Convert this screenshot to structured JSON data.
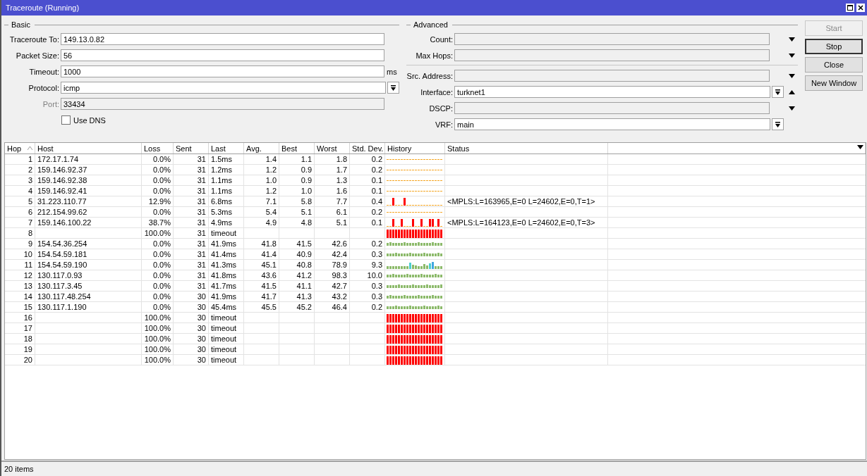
{
  "window": {
    "title": "Traceroute (Running)"
  },
  "basic": {
    "title": "Basic",
    "fields": [
      {
        "label": "Traceroute To:",
        "value": "149.13.0.82",
        "kind": "text",
        "disabled": false
      },
      {
        "label": "Packet Size:",
        "value": "56",
        "kind": "text",
        "disabled": false
      },
      {
        "label": "Timeout:",
        "value": "1000",
        "unit": "ms",
        "kind": "text",
        "disabled": false
      },
      {
        "label": "Protocol:",
        "value": "icmp",
        "kind": "select",
        "disabled": false
      },
      {
        "label": "Port:",
        "value": "33434",
        "kind": "text",
        "disabled": true
      }
    ],
    "use_dns": {
      "label": "Use DNS",
      "checked": false
    }
  },
  "advanced": {
    "title": "Advanced",
    "groups": [
      [
        {
          "label": "Count:",
          "kind": "optional"
        },
        {
          "label": "Max Hops:",
          "kind": "optional"
        }
      ],
      [
        {
          "label": "Src. Address:",
          "kind": "optional"
        },
        {
          "label": "Interface:",
          "value": "turknet1",
          "kind": "select-expanded"
        },
        {
          "label": "DSCP:",
          "kind": "optional"
        },
        {
          "label": "VRF:",
          "value": "main",
          "kind": "select"
        }
      ]
    ]
  },
  "buttons": [
    {
      "label": "Start",
      "disabled": true,
      "focused": false
    },
    {
      "label": "Stop",
      "disabled": false,
      "focused": true
    },
    {
      "label": "Close",
      "disabled": false,
      "focused": false
    },
    {
      "label": "New Window",
      "disabled": false,
      "focused": false
    }
  ],
  "table": {
    "columns": [
      {
        "label": "Hop",
        "sorted": true
      },
      {
        "label": "Host",
        "sorted": false
      },
      {
        "label": "Loss",
        "sorted": false
      },
      {
        "label": "Sent",
        "sorted": false
      },
      {
        "label": "Last",
        "sorted": false
      },
      {
        "label": "Avg.",
        "sorted": false
      },
      {
        "label": "Best",
        "sorted": false
      },
      {
        "label": "Worst",
        "sorted": false
      },
      {
        "label": "Std. Dev.",
        "sorted": false
      },
      {
        "label": "History",
        "sorted": false
      },
      {
        "label": "Status",
        "sorted": false
      }
    ],
    "rows": [
      {
        "hop": "1",
        "host": "172.17.1.74",
        "loss": "0.0%",
        "sent": "31",
        "last": "1.5ms",
        "avg": "1.4",
        "best": "1.1",
        "worst": "1.8",
        "std_dev": "0.2",
        "history": {
          "kind": "dashed"
        }
      },
      {
        "hop": "2",
        "host": "159.146.92.37",
        "loss": "0.0%",
        "sent": "31",
        "last": "1.2ms",
        "avg": "1.2",
        "best": "0.9",
        "worst": "1.7",
        "std_dev": "0.2",
        "history": {
          "kind": "dashed"
        }
      },
      {
        "hop": "3",
        "host": "159.146.92.38",
        "loss": "0.0%",
        "sent": "31",
        "last": "1.1ms",
        "avg": "1.0",
        "best": "0.9",
        "worst": "1.3",
        "std_dev": "0.1",
        "history": {
          "kind": "dashed"
        }
      },
      {
        "hop": "4",
        "host": "159.146.92.41",
        "loss": "0.0%",
        "sent": "31",
        "last": "1.1ms",
        "avg": "1.2",
        "best": "1.0",
        "worst": "1.6",
        "std_dev": "0.1",
        "history": {
          "kind": "dashed"
        }
      },
      {
        "hop": "5",
        "host": "31.223.110.77",
        "loss": "12.9%",
        "sent": "31",
        "last": "6.8ms",
        "avg": "7.1",
        "best": "5.8",
        "worst": "7.7",
        "std_dev": "0.4",
        "history": {
          "kind": "sparse-loss"
        },
        "status": "<MPLS:L=163965,E=0 L=24602,E=0,T=1>"
      },
      {
        "hop": "6",
        "host": "212.154.99.62",
        "loss": "0.0%",
        "sent": "31",
        "last": "5.3ms",
        "avg": "5.4",
        "best": "5.1",
        "worst": "6.1",
        "std_dev": "0.2",
        "history": {
          "kind": "dashed"
        }
      },
      {
        "hop": "7",
        "host": "159.146.100.22",
        "loss": "38.7%",
        "sent": "31",
        "last": "4.9ms",
        "avg": "4.9",
        "best": "4.8",
        "worst": "5.1",
        "std_dev": "0.1",
        "history": {
          "kind": "frequent-loss"
        },
        "status": "<MPLS:L=164123,E=0 L=24602,E=0,T=3>"
      },
      {
        "hop": "8",
        "loss": "100.0%",
        "sent": "31",
        "last": "timeout",
        "history": {
          "kind": "timeout"
        }
      },
      {
        "hop": "9",
        "host": "154.54.36.254",
        "loss": "0.0%",
        "sent": "31",
        "last": "41.9ms",
        "avg": "41.8",
        "best": "41.5",
        "worst": "42.6",
        "std_dev": "0.2",
        "history": {
          "kind": "bars"
        }
      },
      {
        "hop": "10",
        "host": "154.54.59.181",
        "loss": "0.0%",
        "sent": "31",
        "last": "41.4ms",
        "avg": "41.4",
        "best": "40.9",
        "worst": "42.4",
        "std_dev": "0.3",
        "history": {
          "kind": "bars"
        }
      },
      {
        "hop": "11",
        "host": "154.54.59.190",
        "loss": "0.0%",
        "sent": "31",
        "last": "41.3ms",
        "avg": "45.1",
        "best": "40.8",
        "worst": "78.9",
        "std_dev": "9.3",
        "history": {
          "kind": "jitter"
        }
      },
      {
        "hop": "12",
        "host": "130.117.0.93",
        "loss": "0.0%",
        "sent": "31",
        "last": "41.8ms",
        "avg": "43.6",
        "best": "41.2",
        "worst": "98.3",
        "std_dev": "10.0",
        "history": {
          "kind": "bars"
        }
      },
      {
        "hop": "13",
        "host": "130.117.3.45",
        "loss": "0.0%",
        "sent": "31",
        "last": "41.7ms",
        "avg": "41.5",
        "best": "41.1",
        "worst": "42.7",
        "std_dev": "0.3",
        "history": {
          "kind": "bars"
        }
      },
      {
        "hop": "14",
        "host": "130.117.48.254",
        "loss": "0.0%",
        "sent": "30",
        "last": "41.9ms",
        "avg": "41.7",
        "best": "41.3",
        "worst": "43.2",
        "std_dev": "0.3",
        "history": {
          "kind": "bars"
        }
      },
      {
        "hop": "15",
        "host": "130.117.1.190",
        "loss": "0.0%",
        "sent": "30",
        "last": "45.4ms",
        "avg": "45.5",
        "best": "45.2",
        "worst": "46.4",
        "std_dev": "0.2",
        "history": {
          "kind": "bars"
        }
      },
      {
        "hop": "16",
        "loss": "100.0%",
        "sent": "30",
        "last": "timeout",
        "history": {
          "kind": "timeout"
        }
      },
      {
        "hop": "17",
        "loss": "100.0%",
        "sent": "30",
        "last": "timeout",
        "history": {
          "kind": "timeout"
        }
      },
      {
        "hop": "18",
        "loss": "100.0%",
        "sent": "30",
        "last": "timeout",
        "history": {
          "kind": "timeout"
        }
      },
      {
        "hop": "19",
        "loss": "100.0%",
        "sent": "30",
        "last": "timeout",
        "history": {
          "kind": "timeout"
        }
      },
      {
        "hop": "20",
        "loss": "100.0%",
        "sent": "30",
        "last": "timeout",
        "history": {
          "kind": "timeout"
        }
      }
    ]
  },
  "status_bar": {
    "text": "20 items"
  }
}
